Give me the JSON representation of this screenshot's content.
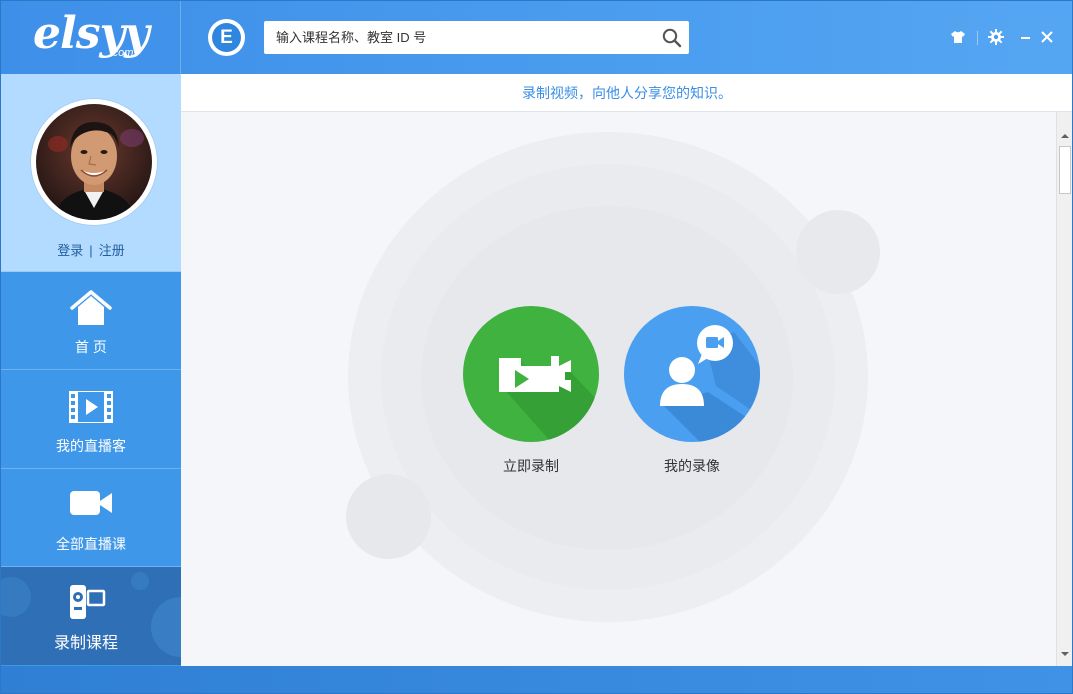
{
  "app": {
    "logo_text": "elsyy",
    "logo_suffix": "·com",
    "badge_letter": "E"
  },
  "search": {
    "placeholder": "输入课程名称、教室 ID 号"
  },
  "window_controls": {
    "icons": [
      "tshirt-skin-icon",
      "gear-icon",
      "minimize-icon",
      "close-icon"
    ]
  },
  "profile": {
    "login_label": "登录",
    "separator": "|",
    "register_label": "注册"
  },
  "sidebar": {
    "items": [
      {
        "label": "首 页",
        "icon": "home-icon"
      },
      {
        "label": "我的直播客",
        "icon": "film-play-icon"
      },
      {
        "label": "全部直播课",
        "icon": "video-camera-icon"
      },
      {
        "label": "录制课程",
        "icon": "camcorder-icon",
        "active": true
      }
    ]
  },
  "main": {
    "banner_text": "录制视频，向他人分享您的知识。",
    "actions": [
      {
        "label": "立即录制",
        "icon": "camcorder-record-icon",
        "color": "#3fb23f"
      },
      {
        "label": "我的录像",
        "icon": "user-video-bubble-icon",
        "color": "#4a9ff0"
      }
    ]
  },
  "colors": {
    "brand_blue": "#3d8fe8",
    "sidebar_blue": "#3f97ea",
    "active_nav": "#2f6fb5",
    "profile_bg": "#b3dbff",
    "banner_text": "#3a8ee6"
  }
}
